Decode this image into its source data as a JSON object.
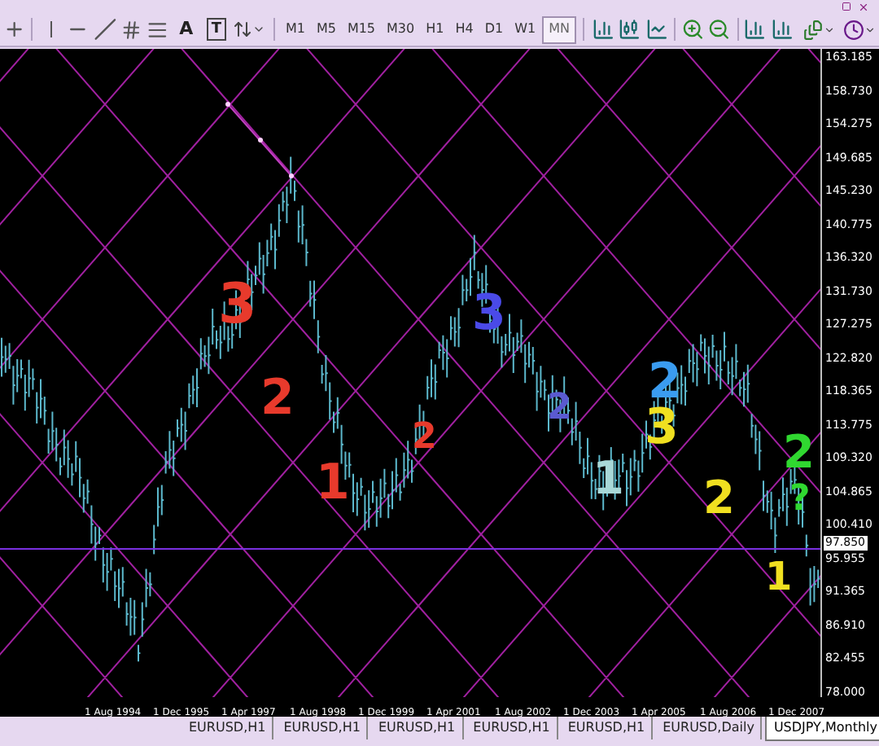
{
  "toolbar": {
    "text_tool": "A",
    "label_tool": "T",
    "timeframes": [
      {
        "label": "M1",
        "selected": false
      },
      {
        "label": "M5",
        "selected": false
      },
      {
        "label": "M15",
        "selected": false
      },
      {
        "label": "M30",
        "selected": false
      },
      {
        "label": "H1",
        "selected": false
      },
      {
        "label": "H4",
        "selected": false
      },
      {
        "label": "D1",
        "selected": false
      },
      {
        "label": "W1",
        "selected": false
      },
      {
        "label": "MN",
        "selected": true
      }
    ]
  },
  "chart": {
    "wave_labels": [
      {
        "text": "3",
        "color": "#e83a2c"
      },
      {
        "text": "2",
        "color": "#e83a2c"
      },
      {
        "text": "1",
        "color": "#e83a2c"
      },
      {
        "text": "2",
        "color": "#e83a2c"
      },
      {
        "text": "3",
        "color": "#4a4ae8"
      },
      {
        "text": "2",
        "color": "#5a5ad0"
      },
      {
        "text": "1",
        "color": "#a8d8d8"
      },
      {
        "text": "2",
        "color": "#3a9cf0"
      },
      {
        "text": "3",
        "color": "#f0e020"
      },
      {
        "text": "2",
        "color": "#f0e020"
      },
      {
        "text": "1",
        "color": "#f0e020"
      },
      {
        "text": "2",
        "color": "#30d830"
      },
      {
        "text": "?",
        "color": "#30d830"
      }
    ],
    "current_price": "97.850",
    "price_axis": [
      "163.185",
      "158.730",
      "154.275",
      "149.685",
      "145.230",
      "140.775",
      "136.320",
      "131.730",
      "127.275",
      "122.820",
      "118.365",
      "113.775",
      "109.320",
      "104.865",
      "100.410",
      "95.955",
      "91.365",
      "86.910",
      "82.455",
      "78.000"
    ],
    "time_axis": [
      "1 Aug 1994",
      "1 Dec 1995",
      "1 Apr 1997",
      "1 Aug 1998",
      "1 Dec 1999",
      "1 Apr 2001",
      "1 Aug 2002",
      "1 Dec 2003",
      "1 Apr 2005",
      "1 Aug 2006",
      "1 Dec 2007"
    ]
  },
  "tabs": [
    {
      "label": "EURUSD,H1",
      "selected": false
    },
    {
      "label": "EURUSD,H1",
      "selected": false
    },
    {
      "label": "EURUSD,H1",
      "selected": false
    },
    {
      "label": "EURUSD,H1",
      "selected": false
    },
    {
      "label": "EURUSD,H1",
      "selected": false
    },
    {
      "label": "EURUSD,Daily",
      "selected": false
    },
    {
      "label": "USDJPY,Monthly",
      "selected": true
    }
  ]
}
